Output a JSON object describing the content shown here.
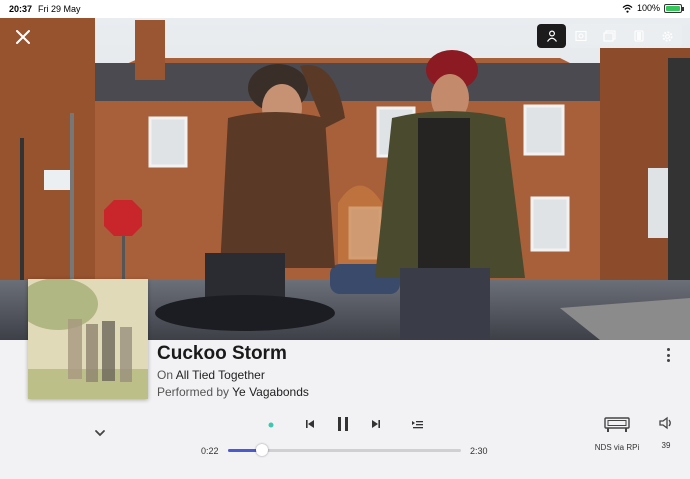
{
  "status_bar": {
    "time": "20:37",
    "date": "Fri 29 May",
    "battery": "100%",
    "battery_level": 1.0,
    "icons": [
      "wifi-icon",
      "battery-icon"
    ]
  },
  "header": {
    "icons": [
      "close-icon",
      "person-icon",
      "image-icon",
      "stacked-photos-icon",
      "tablet-icon",
      "gear-icon"
    ],
    "active": "person-icon"
  },
  "now_playing": {
    "title": "Cuckoo Storm",
    "album_prefix": "On",
    "album": "All Tied Together",
    "artist_prefix": "Performed by",
    "artist": "Ye Vagabonds"
  },
  "playback": {
    "elapsed": "0:22",
    "total": "2:30",
    "progress": 0.147,
    "icons": [
      "radio-dot-icon",
      "previous-track-icon",
      "pause-icon",
      "next-track-icon",
      "queue-icon"
    ],
    "accent_color": "#4a5bcf",
    "radio_color": "#3cc8b0"
  },
  "zone": {
    "name": "NDS via RPi",
    "icon": "streamer-device-icon"
  },
  "volume": {
    "level": "39",
    "icon": "speaker-icon"
  },
  "colors": {
    "panel_background": "#f2f2f4",
    "battery_green": "#35c759"
  }
}
